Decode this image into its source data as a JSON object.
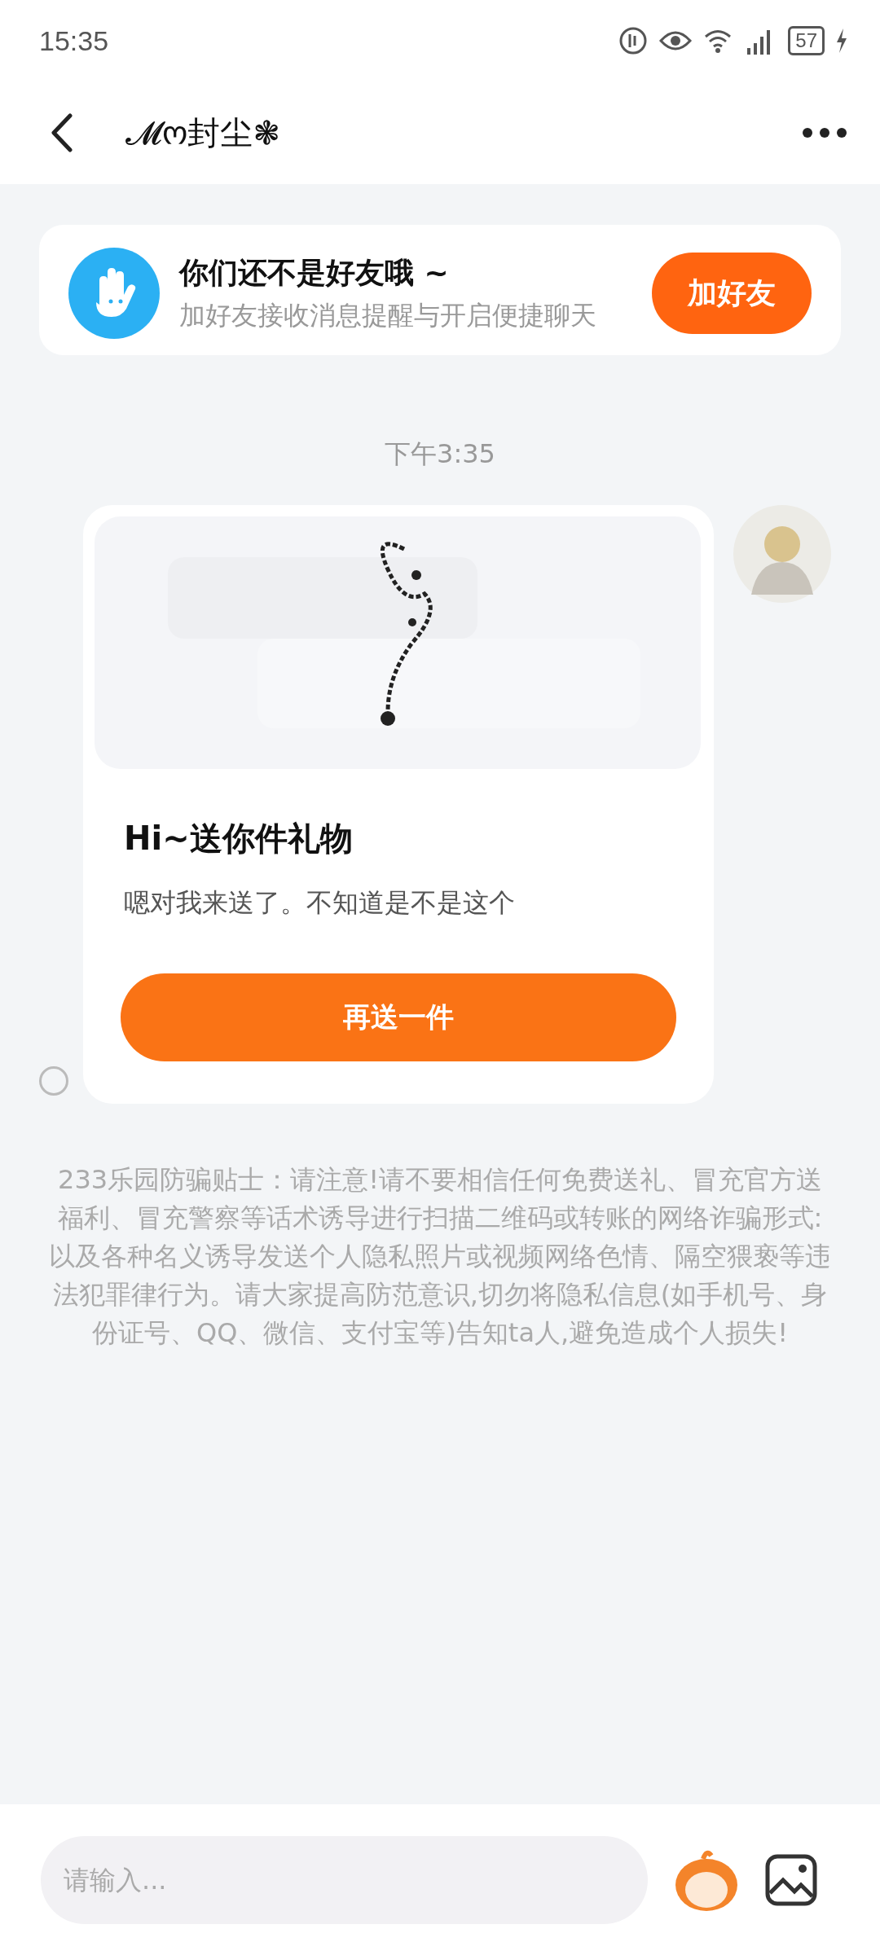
{
  "status_bar": {
    "time": "15:35",
    "battery": "57"
  },
  "header": {
    "title": "𝓜ო封尘❃"
  },
  "friend_banner": {
    "title": "你们还不是好友哦 ~",
    "subtitle": "加好友接收消息提醒与开启便捷聊天",
    "button": "加好友"
  },
  "messages": [
    {
      "kind": "time",
      "text": "下午3:35"
    },
    {
      "kind": "gift",
      "title": "Hi~送你件礼物",
      "body": "嗯对我来送了。不知道是不是这个",
      "button": "再送一件",
      "selected": false
    }
  ],
  "notice": "233乐园防骗贴士：请注意!请不要相信任何免费送礼、冒充官方送福利、冒充警察等话术诱导进行扫描二维码或转账的网络诈骗形式:以及各种名义诱导发送个人隐私照片或视频网络色情、隔空猥亵等违法犯罪律行为。请大家提高防范意识,切勿将隐私信息(如手机号、身份证号、QQ、微信、支付宝等)告知ta人,避免造成个人损失!",
  "input": {
    "placeholder": "请输入..."
  }
}
